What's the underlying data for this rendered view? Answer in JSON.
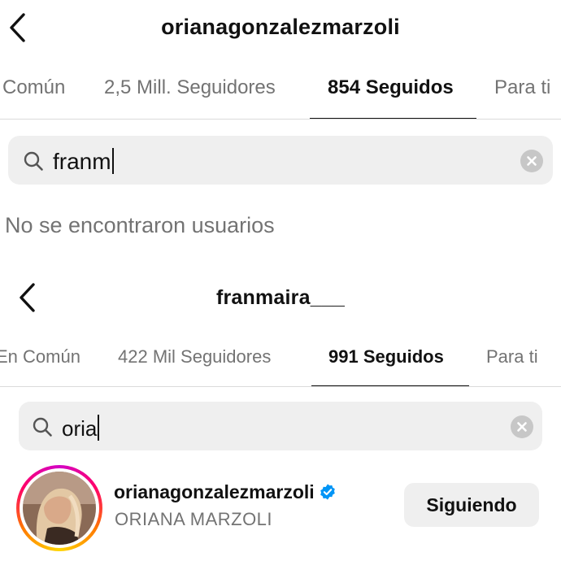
{
  "panel_top": {
    "profile_username": "orianagonzalezmarzoli",
    "tabs": [
      {
        "label": "Común",
        "active": false
      },
      {
        "label": "2,5 Mill. Seguidores",
        "active": false
      },
      {
        "label": "854 Seguidos",
        "active": true
      },
      {
        "label": "Para ti",
        "active": false
      }
    ],
    "search": {
      "query": "franm",
      "icon": "search-icon"
    },
    "empty_message": "No se encontraron usuarios"
  },
  "panel_bottom": {
    "profile_username": "franmaira___",
    "tabs": [
      {
        "label": "En Común",
        "active": false
      },
      {
        "label": "422 Mil Seguidores",
        "active": false
      },
      {
        "label": "991 Seguidos",
        "active": true
      },
      {
        "label": "Para ti",
        "active": false
      }
    ],
    "search": {
      "query": "oria",
      "icon": "search-icon"
    },
    "result": {
      "username": "orianagonzalezmarzoli",
      "full_name": "ORIANA MARZOLI",
      "verified": true,
      "button_label": "Siguiendo"
    }
  },
  "colors": {
    "text_primary": "#111111",
    "text_secondary": "#737373",
    "search_bg": "#efefef",
    "verified_blue": "#0095f6",
    "divider": "#dbdbdb"
  }
}
